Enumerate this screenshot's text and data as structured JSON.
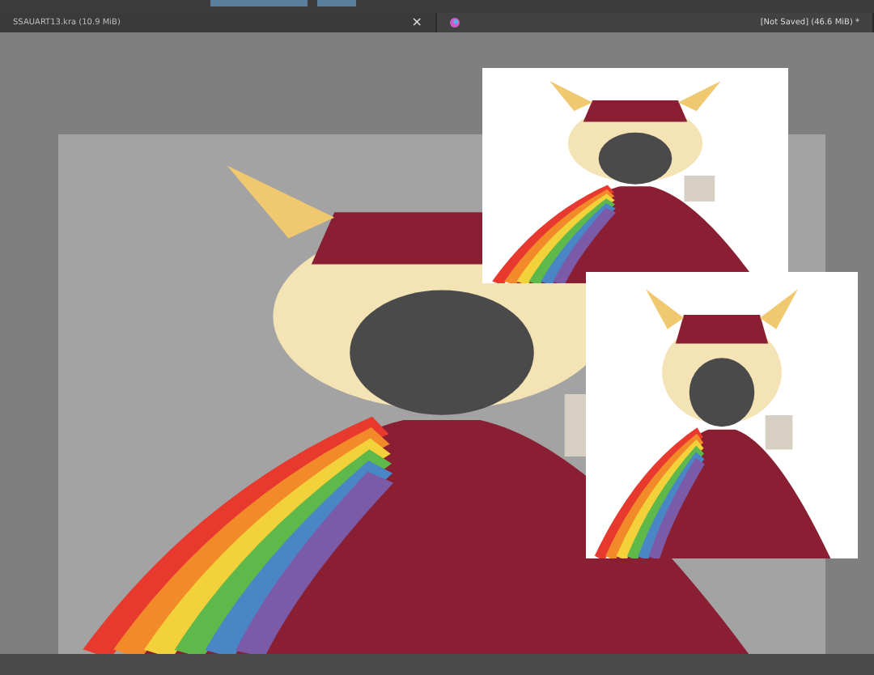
{
  "tabs": [
    {
      "label": "SSAUART13.kra (10.9 MiB)",
      "close": "×",
      "selected": false
    },
    {
      "label": "[Not Saved]  (46.6 MiB) *",
      "selected": true
    }
  ]
}
